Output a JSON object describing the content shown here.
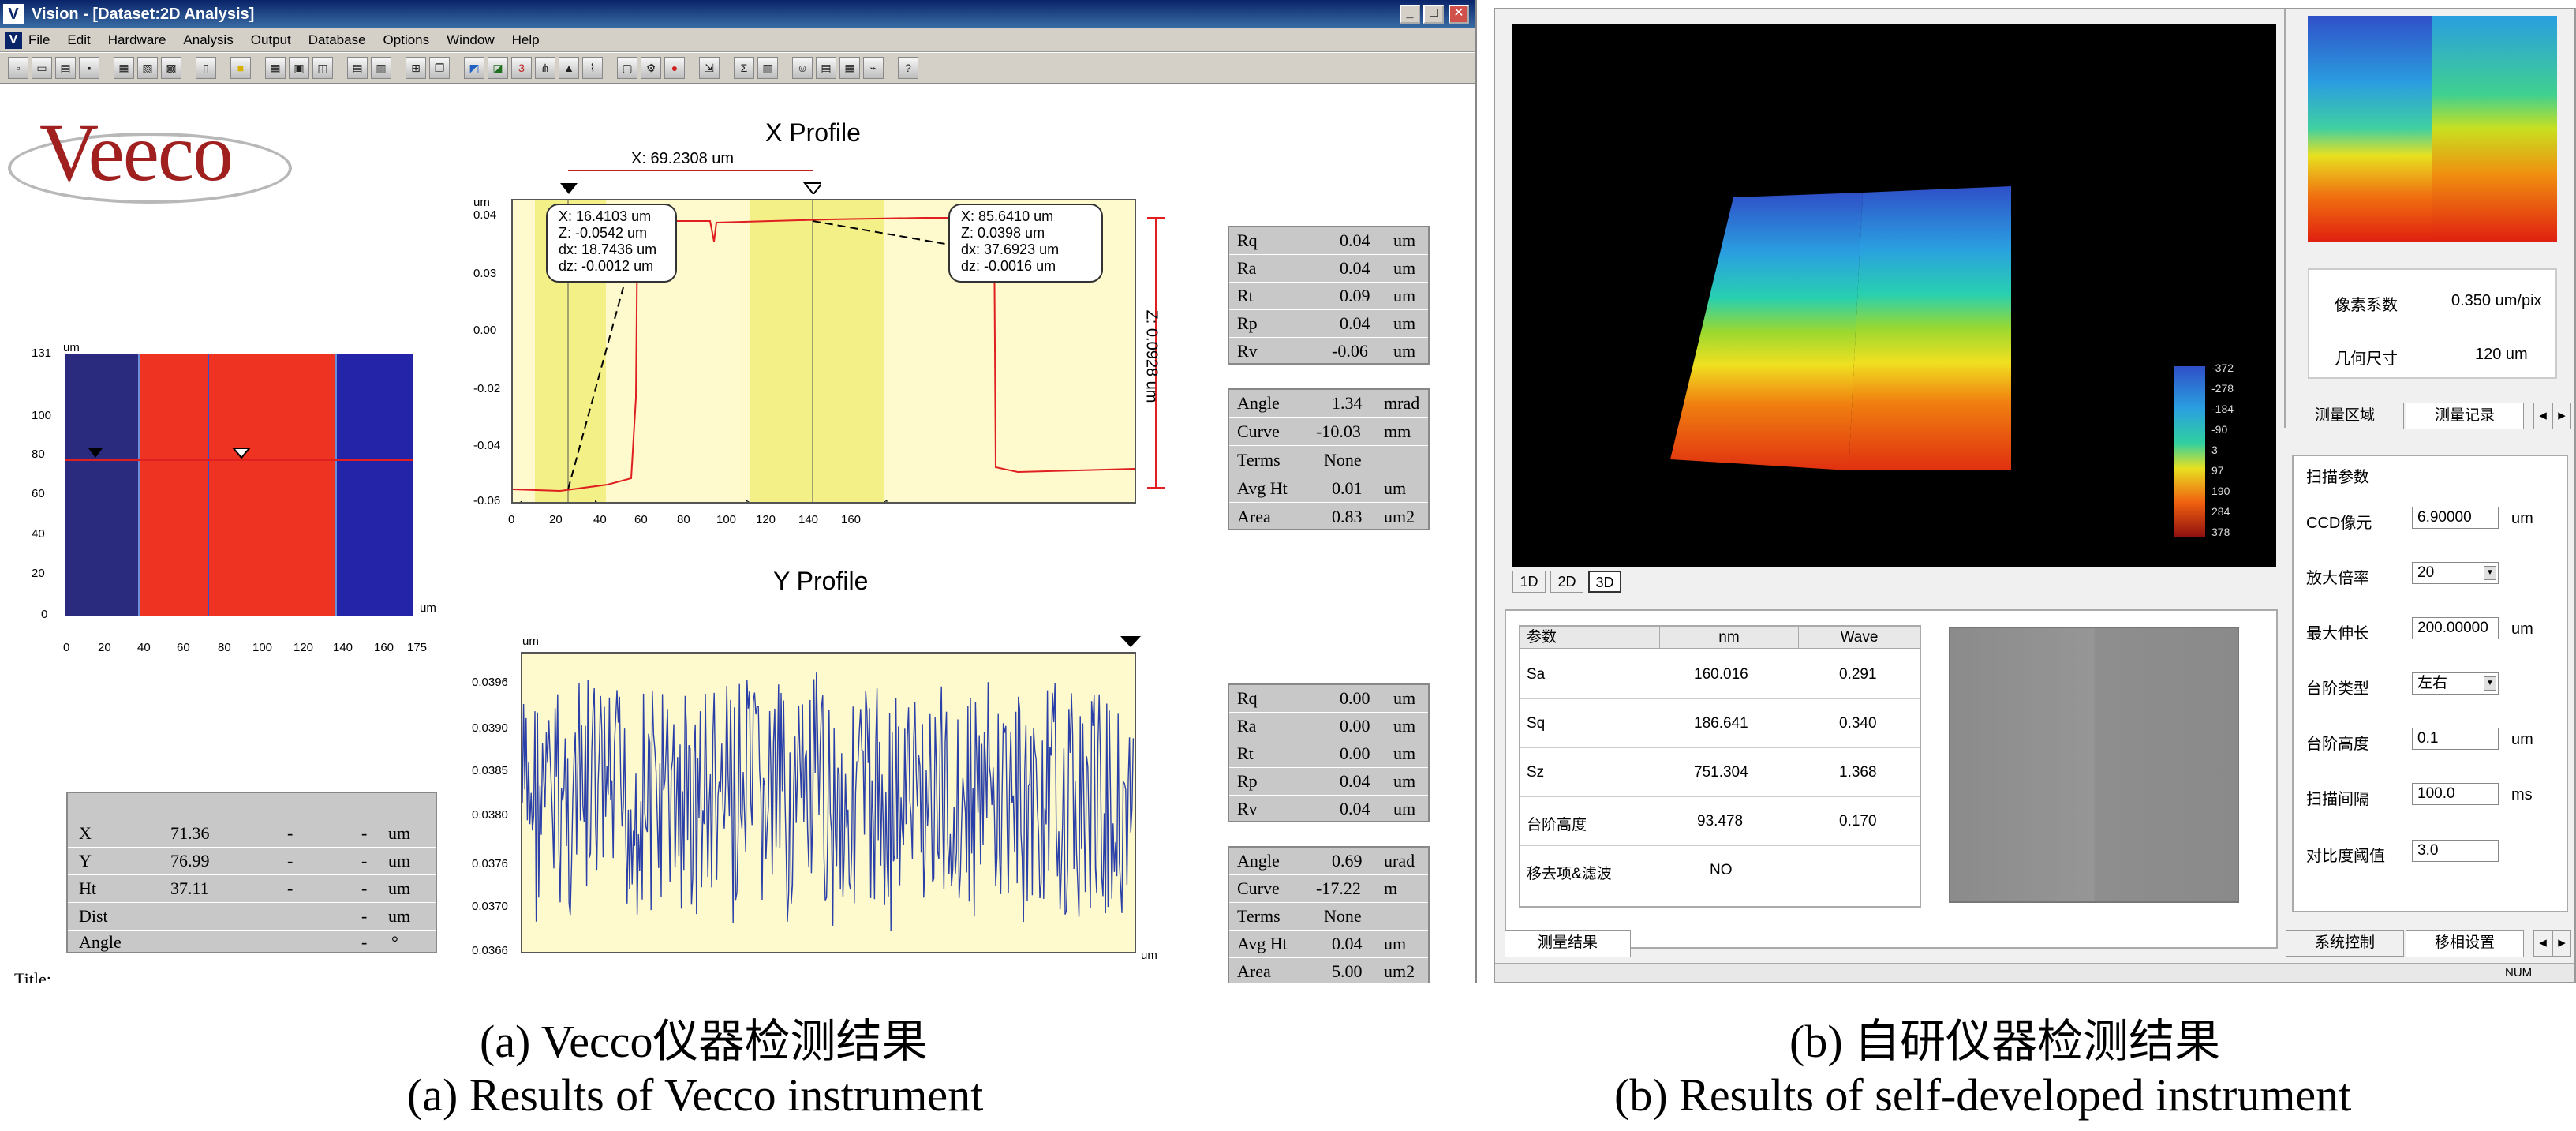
{
  "vision": {
    "title": "Vision - [Dataset:2D Analysis]",
    "menu": [
      "File",
      "Edit",
      "Hardware",
      "Analysis",
      "Output",
      "Database",
      "Options",
      "Window",
      "Help"
    ],
    "logo_text": "Veeco",
    "map2d": {
      "y_unit": "um",
      "x_unit": "um",
      "y_ticks": [
        "131",
        "100",
        "80",
        "60",
        "40",
        "20",
        "0"
      ],
      "x_ticks": [
        "0",
        "20",
        "40",
        "60",
        "80",
        "100",
        "120",
        "140",
        "160",
        "175"
      ]
    },
    "x_profile": {
      "title": "X Profile",
      "unit": "um",
      "cursor_label": "X: 69.2308 um",
      "z_label": "Z: 0.0928 um",
      "y_ticks": [
        "0.04",
        "0.03",
        "0.00",
        "-0.02",
        "-0.04",
        "-0.06"
      ],
      "x_ticks": [
        "0",
        "20",
        "40",
        "60",
        "80",
        "100",
        "120",
        "140",
        "160"
      ],
      "callout_left": [
        "X: 16.4103 um",
        "Z: -0.0542 um",
        "dx: 18.7436 um",
        "dz: -0.0012 um"
      ],
      "callout_right": [
        "X: 85.6410 um",
        "Z: 0.0398 um",
        "dx: 37.6923 um",
        "dz: -0.0016 um"
      ]
    },
    "y_profile": {
      "title": "Y Profile",
      "unit": "um",
      "y_ticks": [
        "0.0396",
        "0.0390",
        "0.0385",
        "0.0380",
        "0.0376",
        "0.0370",
        "0.0366"
      ],
      "x_unit": "um"
    },
    "x_stats_roughness": [
      {
        "k": "Rq",
        "v": "0.04",
        "u": "um"
      },
      {
        "k": "Ra",
        "v": "0.04",
        "u": "um"
      },
      {
        "k": "Rt",
        "v": "0.09",
        "u": "um"
      },
      {
        "k": "Rp",
        "v": "0.04",
        "u": "um"
      },
      {
        "k": "Rv",
        "v": "-0.06",
        "u": "um"
      }
    ],
    "x_stats_shape": [
      {
        "k": "Angle",
        "v": "1.34",
        "u": "mrad"
      },
      {
        "k": "Curve",
        "v": "-10.03",
        "u": "mm"
      },
      {
        "k": "Terms",
        "v": "None",
        "u": ""
      },
      {
        "k": "Avg Ht",
        "v": "0.01",
        "u": "um"
      },
      {
        "k": "Area",
        "v": "0.83",
        "u": "um2"
      }
    ],
    "y_stats_roughness": [
      {
        "k": "Rq",
        "v": "0.00",
        "u": "um"
      },
      {
        "k": "Ra",
        "v": "0.00",
        "u": "um"
      },
      {
        "k": "Rt",
        "v": "0.00",
        "u": "um"
      },
      {
        "k": "Rp",
        "v": "0.04",
        "u": "um"
      },
      {
        "k": "Rv",
        "v": "0.04",
        "u": "um"
      }
    ],
    "y_stats_shape": [
      {
        "k": "Angle",
        "v": "0.69",
        "u": "urad"
      },
      {
        "k": "Curve",
        "v": "-17.22",
        "u": "m"
      },
      {
        "k": "Terms",
        "v": "None",
        "u": ""
      },
      {
        "k": "Avg Ht",
        "v": "0.04",
        "u": "um"
      },
      {
        "k": "Area",
        "v": "5.00",
        "u": "um2"
      }
    ],
    "info": [
      {
        "k": "X",
        "v": "71.36",
        "a": "-",
        "b": "-",
        "u": "um"
      },
      {
        "k": "Y",
        "v": "76.99",
        "a": "-",
        "b": "-",
        "u": "um"
      },
      {
        "k": "Ht",
        "v": "37.11",
        "a": "-",
        "b": "-",
        "u": "um"
      },
      {
        "k": "Dist",
        "v": "",
        "a": "",
        "b": "-",
        "u": "um"
      },
      {
        "k": "Angle",
        "v": "",
        "a": "",
        "b": "-",
        "u": "°"
      }
    ],
    "title_label": "Title:"
  },
  "self": {
    "view_tabs": [
      "1D",
      "2D",
      "3D"
    ],
    "colorbar_ticks": [
      "-372",
      "-278",
      "-184",
      "-90",
      "3",
      "97",
      "190",
      "284",
      "378"
    ],
    "param_table": {
      "headers": [
        "参数",
        "nm",
        "Wave"
      ],
      "rows": [
        {
          "p": "Sa",
          "nm": "160.016",
          "w": "0.291"
        },
        {
          "p": "Sq",
          "nm": "186.641",
          "w": "0.340"
        },
        {
          "p": "Sz",
          "nm": "751.304",
          "w": "1.368"
        },
        {
          "p": "台阶高度",
          "nm": "93.478",
          "w": "0.170"
        },
        {
          "p": "移去项&滤波",
          "nm": "NO",
          "w": ""
        }
      ]
    },
    "result_tab": "测量结果",
    "pixel_info": [
      {
        "k": "像素系数",
        "v": "0.350 um/pix"
      },
      {
        "k": "几何尺寸",
        "v": "120 um"
      }
    ],
    "top_tabs": [
      "测量区域",
      "测量记录"
    ],
    "scan_group_title": "扫描参数",
    "scan_fields": [
      {
        "label": "CCD像元",
        "value": "6.90000",
        "unit": "um",
        "dropdown": false
      },
      {
        "label": "放大倍率",
        "value": "20",
        "unit": "",
        "dropdown": true
      },
      {
        "label": "最大伸长",
        "value": "200.00000",
        "unit": "um",
        "dropdown": false
      },
      {
        "label": "台阶类型",
        "value": "左右",
        "unit": "",
        "dropdown": true
      },
      {
        "label": "台阶高度",
        "value": "0.1",
        "unit": "um",
        "dropdown": false
      },
      {
        "label": "扫描间隔",
        "value": "100.0",
        "unit": "ms",
        "dropdown": false
      },
      {
        "label": "对比度阈值",
        "value": "3.0",
        "unit": "",
        "dropdown": false
      }
    ],
    "bottom_tabs": [
      "系统控制",
      "移相设置"
    ],
    "status_num": "NUM"
  },
  "captions": {
    "a_cn": "(a) Vecco仪器检测结果",
    "a_en": "(a) Results of Vecco instrument",
    "b_cn": "(b) 自研仪器检测结果",
    "b_en": "(b) Results of self-developed instrument"
  }
}
